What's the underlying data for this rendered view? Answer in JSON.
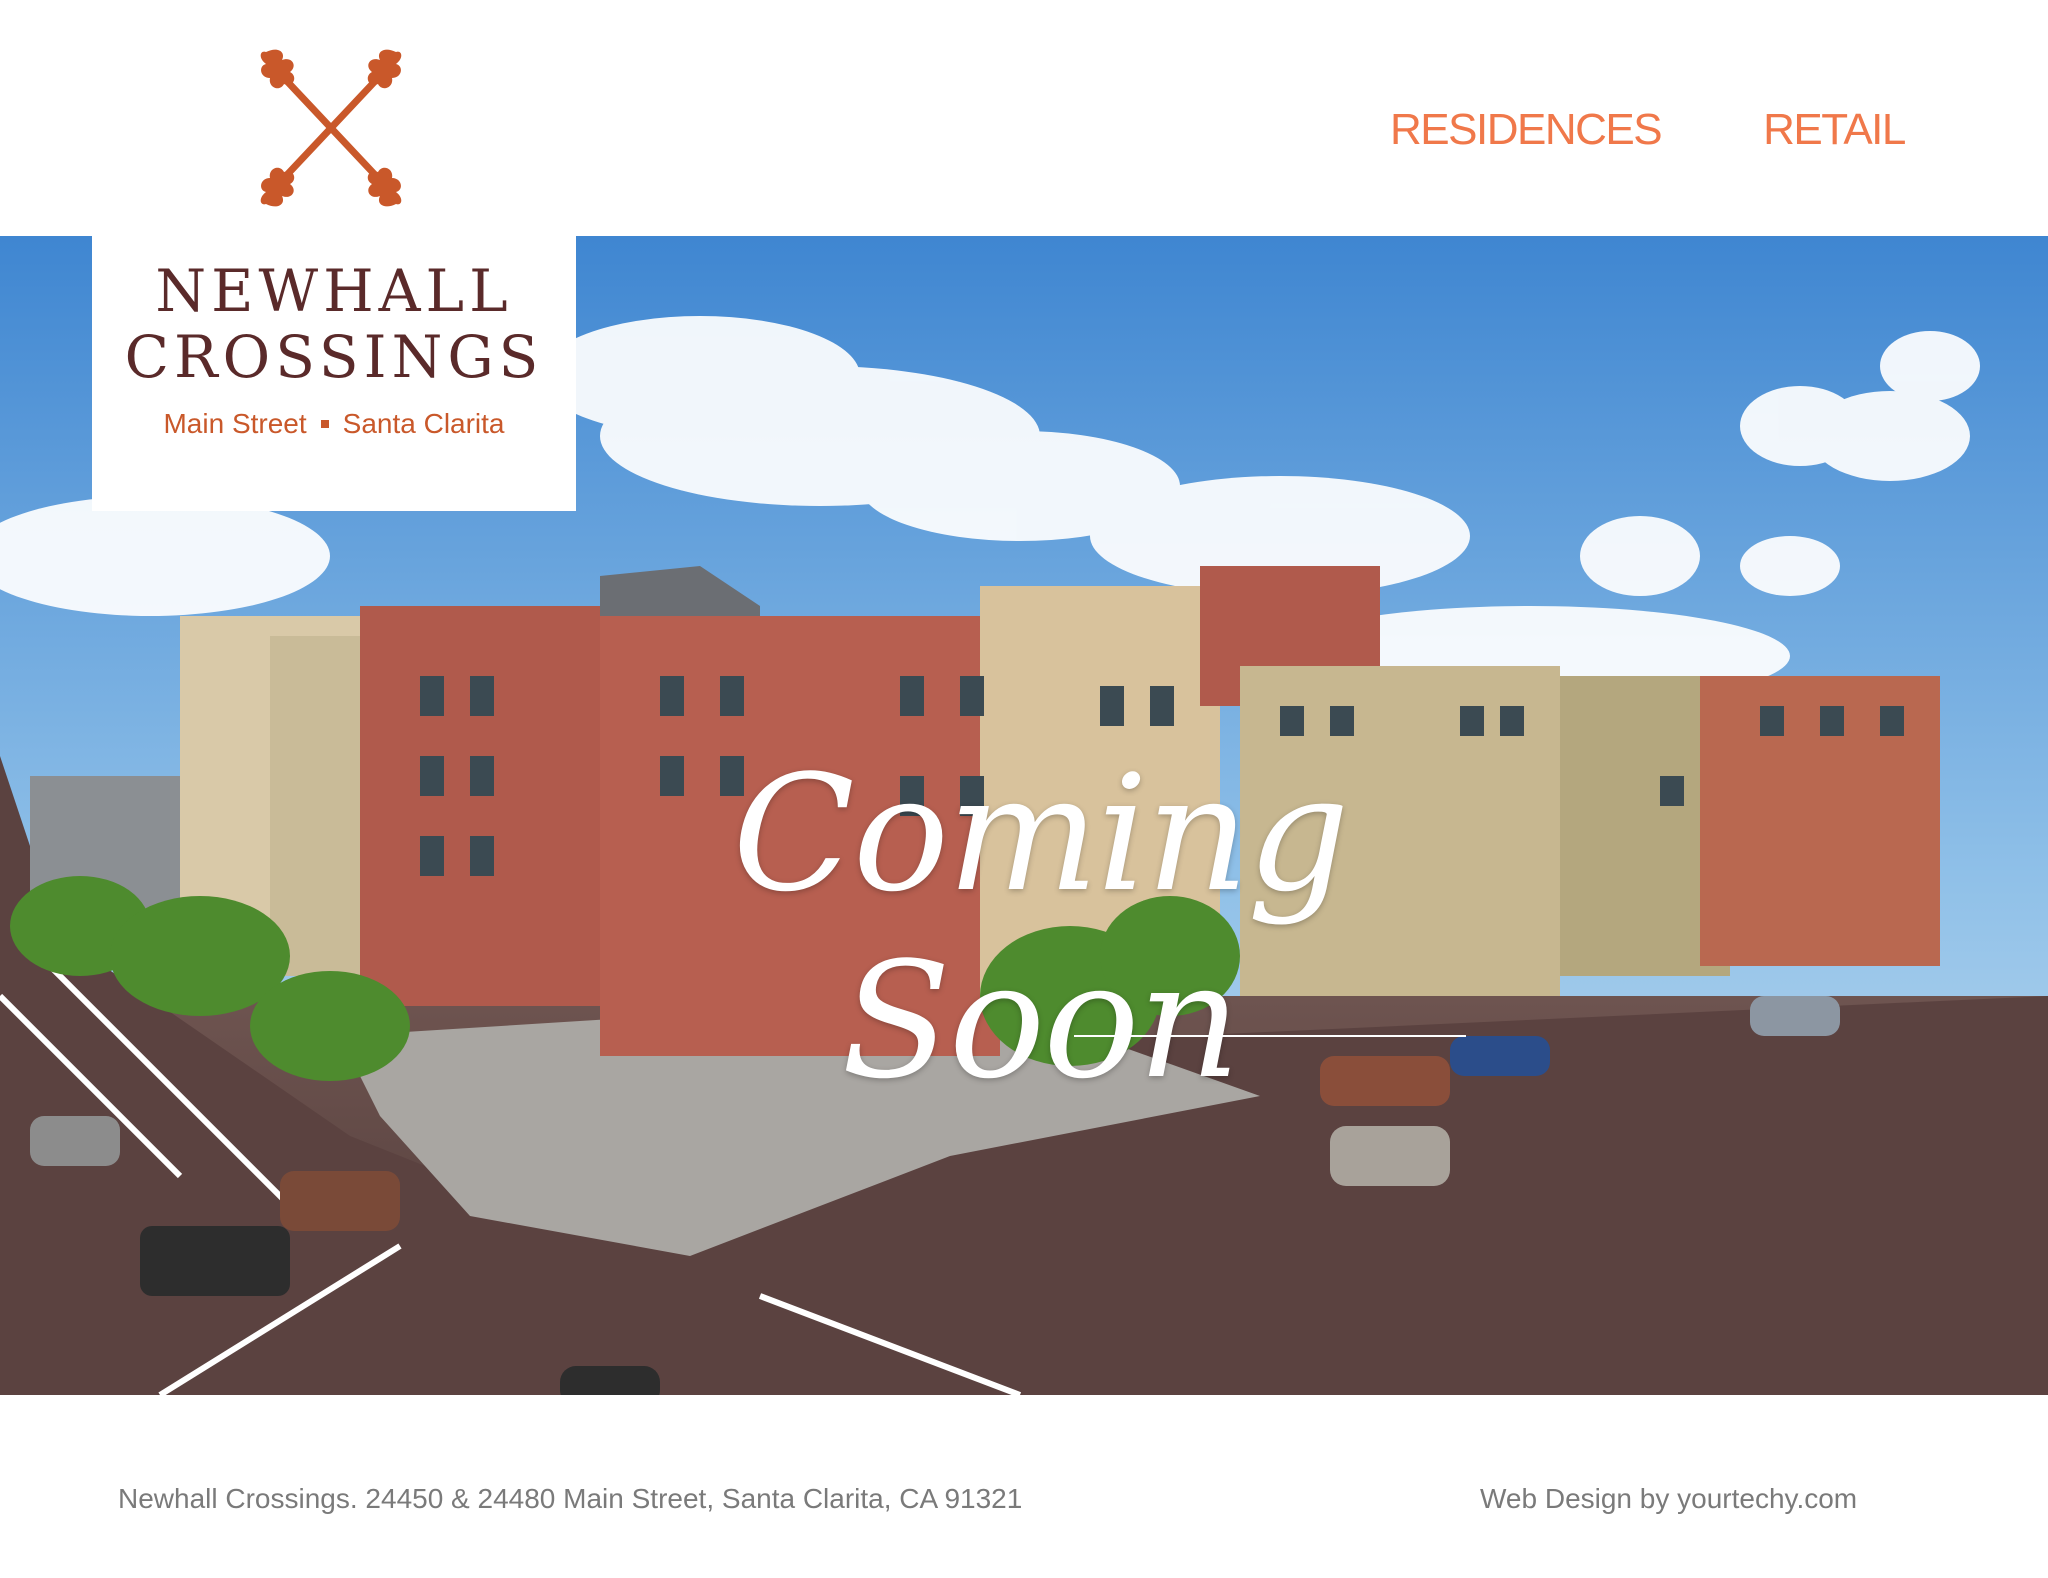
{
  "nav": {
    "residences_label": "RESIDENCES",
    "retail_label": "RETAIL"
  },
  "logo": {
    "line1": "NEWHALL",
    "line2": "CROSSINGS",
    "tagline_left": "Main Street",
    "tagline_right": "Santa Clarita",
    "mark_icon": "crossed-oak-leaves-icon"
  },
  "hero": {
    "headline": "Coming Soon",
    "image": "rendering-of-mixed-use-buildings"
  },
  "footer": {
    "address": "Newhall Crossings. 24450 & 24480 Main Street, Santa Clarita, CA 91321",
    "credit": "Web Design by yourtechy.com"
  },
  "colors": {
    "accent_orange": "#f0784a",
    "logo_brown": "#5a2a2a",
    "logo_rust": "#c9582a",
    "footer_gray": "#7a7a7a"
  }
}
